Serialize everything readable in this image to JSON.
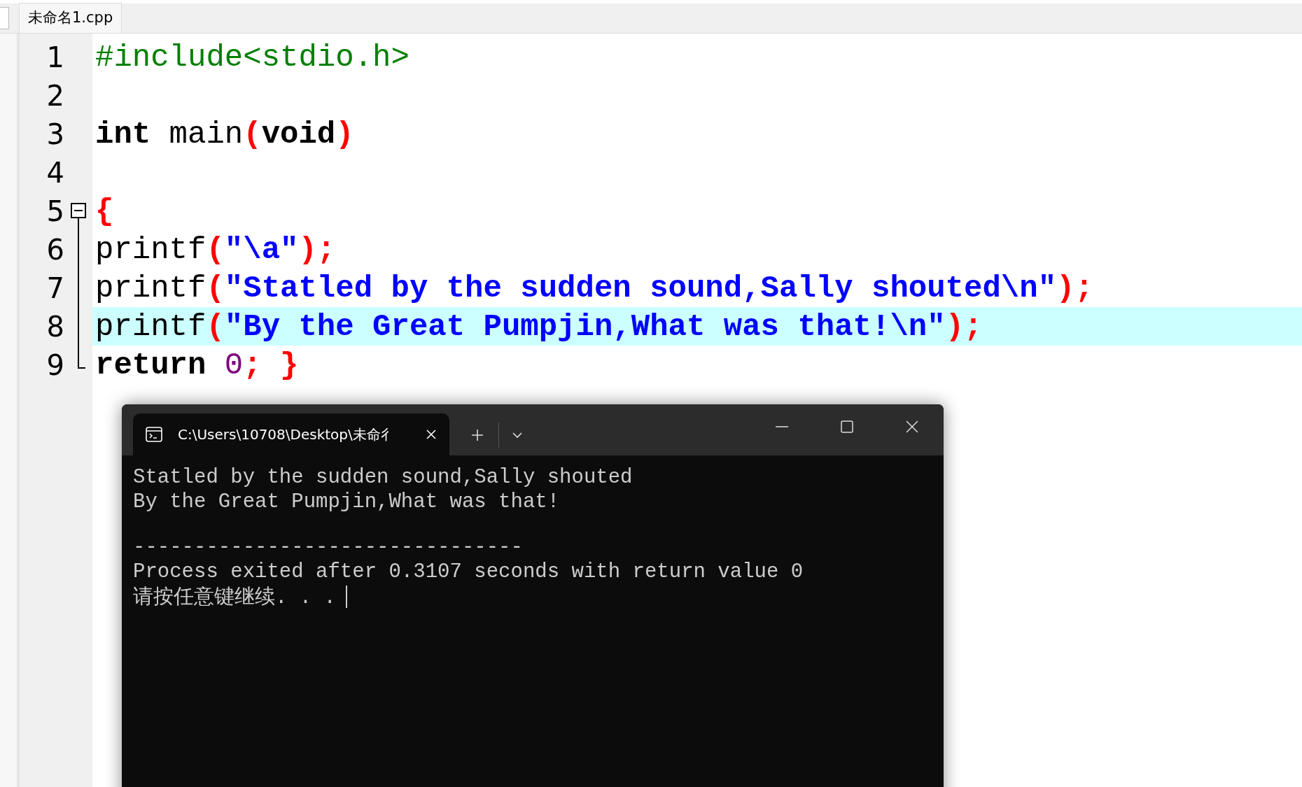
{
  "editor_tabs": [
    {
      "label": "未命名1.cpp",
      "selected": true
    }
  ],
  "code_lines": [
    {
      "number": "1",
      "highlighted": false,
      "tokens": [
        {
          "kind": "preprocessor",
          "text": "#include<stdio.h>"
        }
      ]
    },
    {
      "number": "2",
      "highlighted": false
    },
    {
      "number": "3",
      "highlighted": false,
      "tokens": [
        {
          "kind": "keyword",
          "text": "int"
        },
        {
          "kind": "plain",
          "text": " main"
        },
        {
          "kind": "symbol",
          "text": "("
        },
        {
          "kind": "keyword",
          "text": "void"
        },
        {
          "kind": "symbol",
          "text": ")"
        }
      ]
    },
    {
      "number": "4",
      "highlighted": false
    },
    {
      "number": "5",
      "highlighted": false,
      "fold": true,
      "tokens": [
        {
          "kind": "symbol",
          "text": "{"
        }
      ]
    },
    {
      "number": "6",
      "highlighted": false,
      "tokens": [
        {
          "kind": "plain",
          "text": "printf"
        },
        {
          "kind": "symbol",
          "text": "("
        },
        {
          "kind": "string",
          "text": "\"\\a\""
        },
        {
          "kind": "symbol",
          "text": ");"
        }
      ]
    },
    {
      "number": "7",
      "highlighted": false,
      "tokens": [
        {
          "kind": "plain",
          "text": "printf"
        },
        {
          "kind": "symbol",
          "text": "("
        },
        {
          "kind": "string",
          "text": "\"Statled by the sudden sound,Sally shouted\\n\""
        },
        {
          "kind": "symbol",
          "text": ");"
        }
      ]
    },
    {
      "number": "8",
      "highlighted": true,
      "tokens": [
        {
          "kind": "plain",
          "text": "printf"
        },
        {
          "kind": "symbol",
          "text": "("
        },
        {
          "kind": "string",
          "text": "\"By the Great Pumpjin,What was that!\\n\""
        },
        {
          "kind": "symbol",
          "text": ");"
        }
      ]
    },
    {
      "number": "9",
      "highlighted": false,
      "tokens": [
        {
          "kind": "keyword",
          "text": "return"
        },
        {
          "kind": "number",
          "text": " 0"
        },
        {
          "kind": "symbol",
          "text": "; }"
        }
      ]
    }
  ],
  "terminal": {
    "tab_title": "C:\\Users\\10708\\Desktop\\未命彳",
    "output": [
      {
        "kind": "text",
        "text": "Statled by the sudden sound,Sally shouted"
      },
      {
        "kind": "text",
        "text": "By the Great Pumpjin,What was that!"
      },
      {
        "kind": "separator",
        "text": "--------------------------------"
      },
      {
        "kind": "text",
        "text": "Process exited after 0.3107 seconds with return value 0"
      },
      {
        "kind": "prompt",
        "text": "请按任意键继续. . ."
      }
    ]
  }
}
